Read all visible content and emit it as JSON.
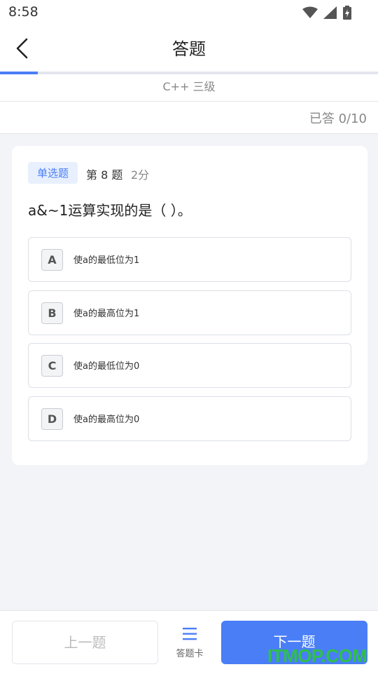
{
  "status_bar": {
    "time": "8:58"
  },
  "header": {
    "title": "答题"
  },
  "progress": {
    "fraction": 0.1
  },
  "subject": "C++ 三级",
  "answered": "已答 0/10",
  "question": {
    "type": "单选题",
    "number": "第 8 题",
    "points": "2分",
    "text": "a&~1运算实现的是（ ）。",
    "options": [
      {
        "letter": "A",
        "text": "使a的最低位为1"
      },
      {
        "letter": "B",
        "text": "使a的最高位为1"
      },
      {
        "letter": "C",
        "text": "使a的最低位为0"
      },
      {
        "letter": "D",
        "text": "使a的最高位为0"
      }
    ]
  },
  "footer": {
    "prev_label": "上一题",
    "card_label": "答题卡",
    "next_label": "下一题"
  },
  "watermark": "ITMOP.COM",
  "colors": {
    "accent": "#4a7ef6",
    "watermark": "#30c04a"
  }
}
